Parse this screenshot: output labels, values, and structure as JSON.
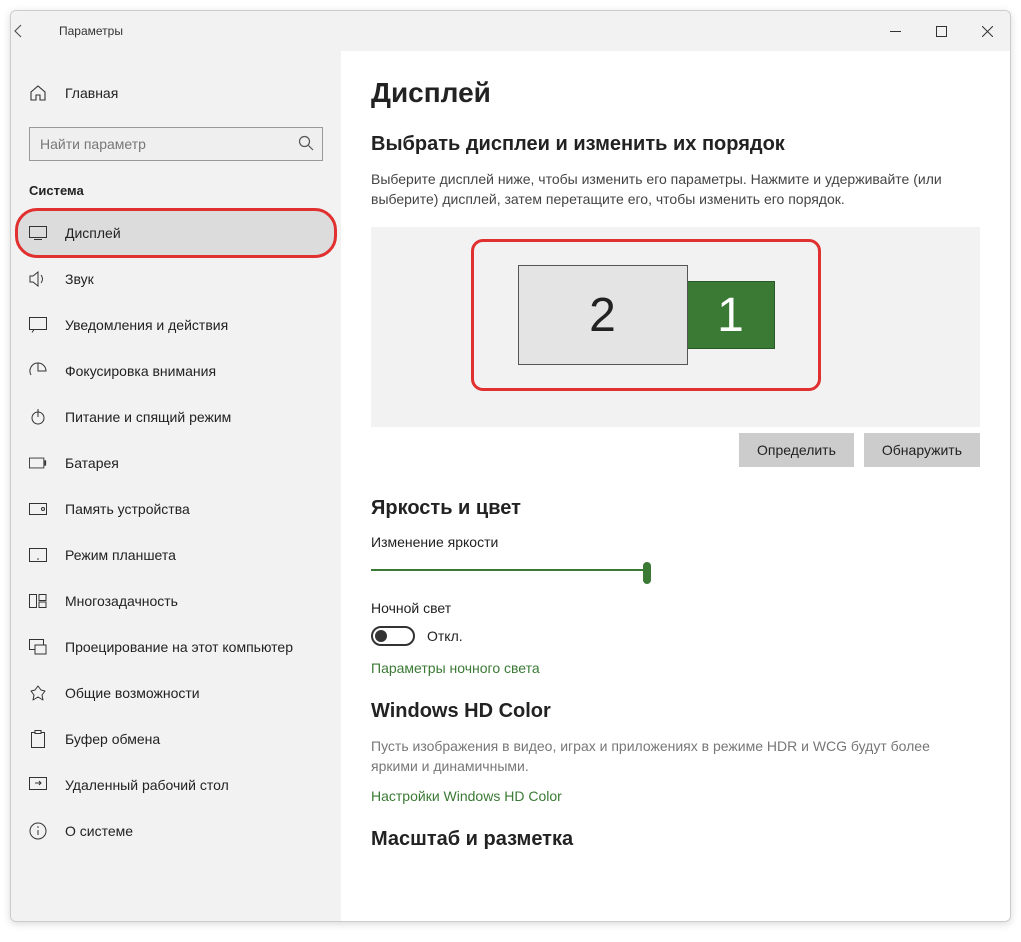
{
  "window": {
    "title": "Параметры"
  },
  "sidebar": {
    "home": "Главная",
    "search_placeholder": "Найти параметр",
    "category": "Система",
    "items": [
      {
        "label": "Дисплей",
        "icon": "display"
      },
      {
        "label": "Звук",
        "icon": "sound"
      },
      {
        "label": "Уведомления и действия",
        "icon": "notifications"
      },
      {
        "label": "Фокусировка внимания",
        "icon": "focus"
      },
      {
        "label": "Питание и спящий режим",
        "icon": "power"
      },
      {
        "label": "Батарея",
        "icon": "battery"
      },
      {
        "label": "Память устройства",
        "icon": "storage"
      },
      {
        "label": "Режим планшета",
        "icon": "tablet"
      },
      {
        "label": "Многозадачность",
        "icon": "multitask"
      },
      {
        "label": "Проецирование на этот компьютер",
        "icon": "project"
      },
      {
        "label": "Общие возможности",
        "icon": "shared"
      },
      {
        "label": "Буфер обмена",
        "icon": "clipboard"
      },
      {
        "label": "Удаленный рабочий стол",
        "icon": "remote"
      },
      {
        "label": "О системе",
        "icon": "about"
      }
    ]
  },
  "main": {
    "title": "Дисплей",
    "arrange_heading": "Выбрать дисплеи и изменить их порядок",
    "arrange_desc": "Выберите дисплей ниже, чтобы изменить его параметры. Нажмите и удерживайте (или выберите) дисплей, затем перетащите его, чтобы изменить его порядок.",
    "monitors": {
      "primary": "2",
      "secondary": "1"
    },
    "identify_btn": "Определить",
    "detect_btn": "Обнаружить",
    "brightness_heading": "Яркость и цвет",
    "brightness_label": "Изменение яркости",
    "nightlight_label": "Ночной свет",
    "toggle_off": "Откл.",
    "nightlight_link": "Параметры ночного света",
    "hdcolor_heading": "Windows HD Color",
    "hdcolor_desc": "Пусть изображения в видео, играх и приложениях в режиме HDR и WCG будут более яркими и динамичными.",
    "hdcolor_link": "Настройки Windows HD Color",
    "scale_heading": "Масштаб и разметка"
  }
}
